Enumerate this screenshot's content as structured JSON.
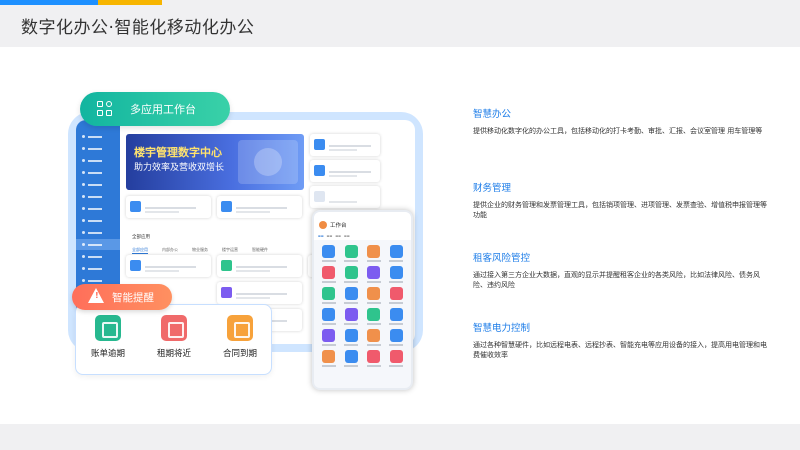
{
  "slide": {
    "title": "数字化办公·智能化移动化办公",
    "accent_colors": [
      "#1e90ff",
      "#f7b500"
    ]
  },
  "workbench": {
    "pill_label": "多应用工作台",
    "pill_icon": "grid-icon",
    "banner_title": "楼宇管理数字中心",
    "banner_subtitle": "助力效率及营收双增长",
    "sidebar_icons": 14,
    "section_label": "全部应用",
    "tabs": [
      "全部应用",
      "内部办公",
      "物业服务",
      "楼宇运营",
      "智能硬件"
    ]
  },
  "phone": {
    "title": "工作台",
    "icon_colors": [
      "#3b8cf0",
      "#2fc48d",
      "#f0904b",
      "#3b8cf0",
      "#f05a6c",
      "#2fc48d",
      "#7c5cf0",
      "#3b8cf0",
      "#2fc48d",
      "#3b8cf0",
      "#f0904b",
      "#f05a6c",
      "#3b8cf0",
      "#7c5cf0",
      "#2fc48d",
      "#3b8cf0",
      "#7c5cf0",
      "#3b8cf0",
      "#f0904b",
      "#3b8cf0",
      "#f0904b",
      "#3b8cf0",
      "#f05a6c",
      "#f05a6c"
    ]
  },
  "alerts": {
    "pill_label": "智能提醒",
    "pill_icon": "warning-icon",
    "items": [
      {
        "label": "账单逾期",
        "icon": "bill-icon",
        "color": "#27b88f"
      },
      {
        "label": "租期将近",
        "icon": "house-icon",
        "color": "#f06a6a"
      },
      {
        "label": "合同到期",
        "icon": "contract-icon",
        "color": "#f7a23b"
      }
    ]
  },
  "features": [
    {
      "title": "智慧办公",
      "desc": "提供移动化数字化的办公工具，包括移动化的打卡考勤、审批、汇报、会议室管理 用车管理等"
    },
    {
      "title": "财务管理",
      "desc": "提供企业的财务管理和发票管理工具，包括销项管理、进项管理、发票查验、增值税申报管理等功能"
    },
    {
      "title": "租客风险管控",
      "desc": "通过接入第三方企业大数据，直观的显示并提醒租客企业的各类风险，比如法律风险、债务风险、违约风险"
    },
    {
      "title": "智慧电力控制",
      "desc": "通过各种智慧硬件，比如远程电表、远程抄表、智能充电等应用设备的接入，提高用电管理和电费催收效率"
    }
  ]
}
